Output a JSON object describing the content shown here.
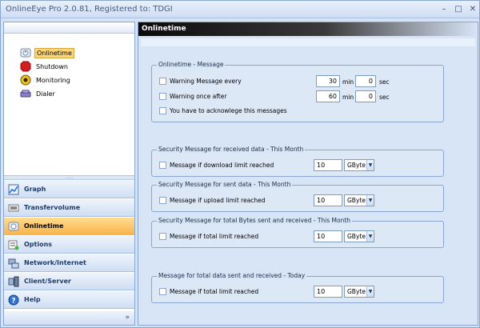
{
  "window": {
    "title": "OnlineEye Pro 2.0.81, Registered to: TDGI"
  },
  "tree": {
    "items": [
      {
        "label": "Onlinetime",
        "icon": "clock-icon",
        "selected": true
      },
      {
        "label": "Shutdown",
        "icon": "stop-sign-icon",
        "selected": false
      },
      {
        "label": "Monitoring",
        "icon": "monitoring-icon",
        "selected": false
      },
      {
        "label": "Dialer",
        "icon": "dialer-icon",
        "selected": false
      }
    ]
  },
  "nav": {
    "items": [
      {
        "label": "Graph",
        "icon": "graph-icon",
        "active": false
      },
      {
        "label": "Transfervolume",
        "icon": "transfer-icon",
        "active": false
      },
      {
        "label": "Onlinetime",
        "icon": "clock-icon",
        "active": true
      },
      {
        "label": "Options",
        "icon": "options-icon",
        "active": false
      },
      {
        "label": "Network/Internet",
        "icon": "network-icon",
        "active": false
      },
      {
        "label": "Client/Server",
        "icon": "server-icon",
        "active": false
      },
      {
        "label": "Help",
        "icon": "help-icon",
        "active": false
      }
    ]
  },
  "panel": {
    "header": "Onlinetime",
    "message_group": {
      "title": "Onlinetime - Message",
      "warn_every_label": "Warning Message every",
      "warn_every_min": "30",
      "warn_every_sec": "0",
      "warn_once_label": "Warning once after",
      "warn_once_min": "60",
      "warn_once_sec": "0",
      "ack_label": "You have to acknowlege this messages",
      "min_unit": "min",
      "sec_unit": "sec"
    },
    "received_group": {
      "title": "Security Message for received data - This Month",
      "label": "Message if download limit reached",
      "value": "10",
      "unit": "GByte"
    },
    "sent_group": {
      "title": "Security Message for sent data - This Month",
      "label": "Message if upload limit reached",
      "value": "10",
      "unit": "GByte"
    },
    "total_group": {
      "title": "Security Message for total Bytes sent and received - This Month",
      "label": "Message if total limit reached",
      "value": "10",
      "unit": "GByte"
    },
    "today_group": {
      "title": "Message for total data sent and received - Today",
      "label": "Message if total limit reached",
      "value": "10",
      "unit": "GByte"
    }
  }
}
